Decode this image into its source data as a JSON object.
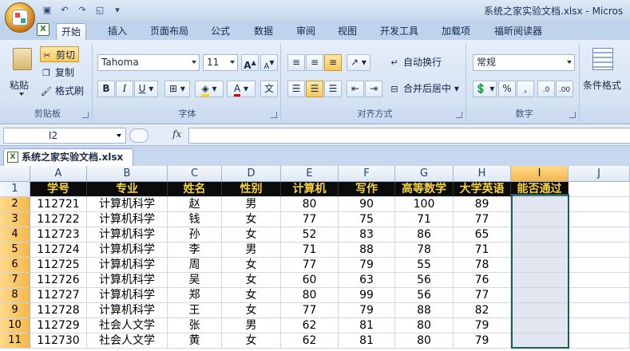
{
  "window": {
    "title": "系统之家实验文档.xlsx - Micros"
  },
  "quick_access": {
    "save_icon": "save-icon",
    "undo_icon": "undo-icon",
    "redo_icon": "redo-icon",
    "preview_icon": "print-preview-icon"
  },
  "ribbon_tabs": [
    "开始",
    "插入",
    "页面布局",
    "公式",
    "数据",
    "审阅",
    "视图",
    "开发工具",
    "加载项",
    "福昕阅读器"
  ],
  "clipboard": {
    "paste": "粘贴",
    "cut": "剪切",
    "copy": "复制",
    "format_painter": "格式刷",
    "group_label": "剪贴板"
  },
  "font": {
    "name": "Tahoma",
    "size": "11",
    "grow": "A",
    "shrink": "A",
    "bold": "B",
    "italic": "I",
    "underline": "U",
    "group_label": "字体",
    "phonetic": "文"
  },
  "alignment": {
    "wrap_text": "自动换行",
    "merge_center": "合并后居中",
    "group_label": "对齐方式"
  },
  "number": {
    "format": "常规",
    "percent": "%",
    "comma": ",",
    "group_label": "数字"
  },
  "styles": {
    "conditional_format": "条件格式"
  },
  "formula_bar": {
    "name_box": "I2",
    "fx": "fx",
    "content": ""
  },
  "workbook_tab": {
    "name": "系统之家实验文档.xlsx"
  },
  "grid": {
    "columns": [
      "A",
      "B",
      "C",
      "D",
      "E",
      "F",
      "G",
      "H",
      "I",
      "J"
    ],
    "selected_column": "I",
    "row_numbers": [
      "1",
      "2",
      "3",
      "4",
      "5",
      "6",
      "7",
      "8",
      "9",
      "10",
      "11"
    ],
    "header_row": [
      "学号",
      "专业",
      "姓名",
      "性别",
      "计算机",
      "写作",
      "高等数学",
      "大学英语",
      "能否通过"
    ],
    "rows": [
      [
        "112721",
        "计算机科学",
        "赵",
        "男",
        "80",
        "90",
        "100",
        "89",
        ""
      ],
      [
        "112722",
        "计算机科学",
        "钱",
        "女",
        "77",
        "75",
        "71",
        "77",
        ""
      ],
      [
        "112723",
        "计算机科学",
        "孙",
        "女",
        "52",
        "83",
        "86",
        "65",
        ""
      ],
      [
        "112724",
        "计算机科学",
        "李",
        "男",
        "71",
        "88",
        "78",
        "71",
        ""
      ],
      [
        "112725",
        "计算机科学",
        "周",
        "女",
        "77",
        "79",
        "55",
        "78",
        ""
      ],
      [
        "112726",
        "计算机科学",
        "吴",
        "女",
        "60",
        "63",
        "56",
        "76",
        ""
      ],
      [
        "112727",
        "计算机科学",
        "郑",
        "女",
        "80",
        "99",
        "56",
        "77",
        ""
      ],
      [
        "112728",
        "计算机科学",
        "王",
        "女",
        "77",
        "79",
        "88",
        "82",
        ""
      ],
      [
        "112729",
        "社会人文学",
        "张",
        "男",
        "62",
        "81",
        "80",
        "79",
        ""
      ],
      [
        "112730",
        "社会人文学",
        "黄",
        "女",
        "62",
        "81",
        "80",
        "79",
        ""
      ]
    ]
  }
}
